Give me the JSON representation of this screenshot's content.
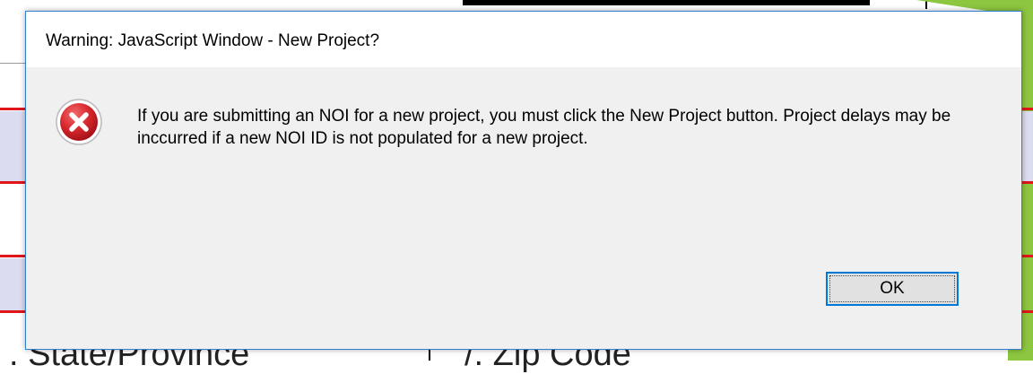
{
  "dialog": {
    "title": "Warning: JavaScript Window - New Project?",
    "message": "If you are submitting an NOI for a new project, you must click the New Project button.  Project delays may be inccurred if a new NOI ID is not populated for a new project.",
    "icon": "error-icon",
    "ok_label": "OK"
  },
  "background": {
    "left_field_label": ". State/Province",
    "right_field_label": "/. Zip Code"
  },
  "colors": {
    "dialog_border": "#2f7fd3",
    "button_focus": "#0078d7",
    "error_red": "#d6262d",
    "form_red_line": "#e0161b",
    "accent_green": "#8dc63f"
  }
}
